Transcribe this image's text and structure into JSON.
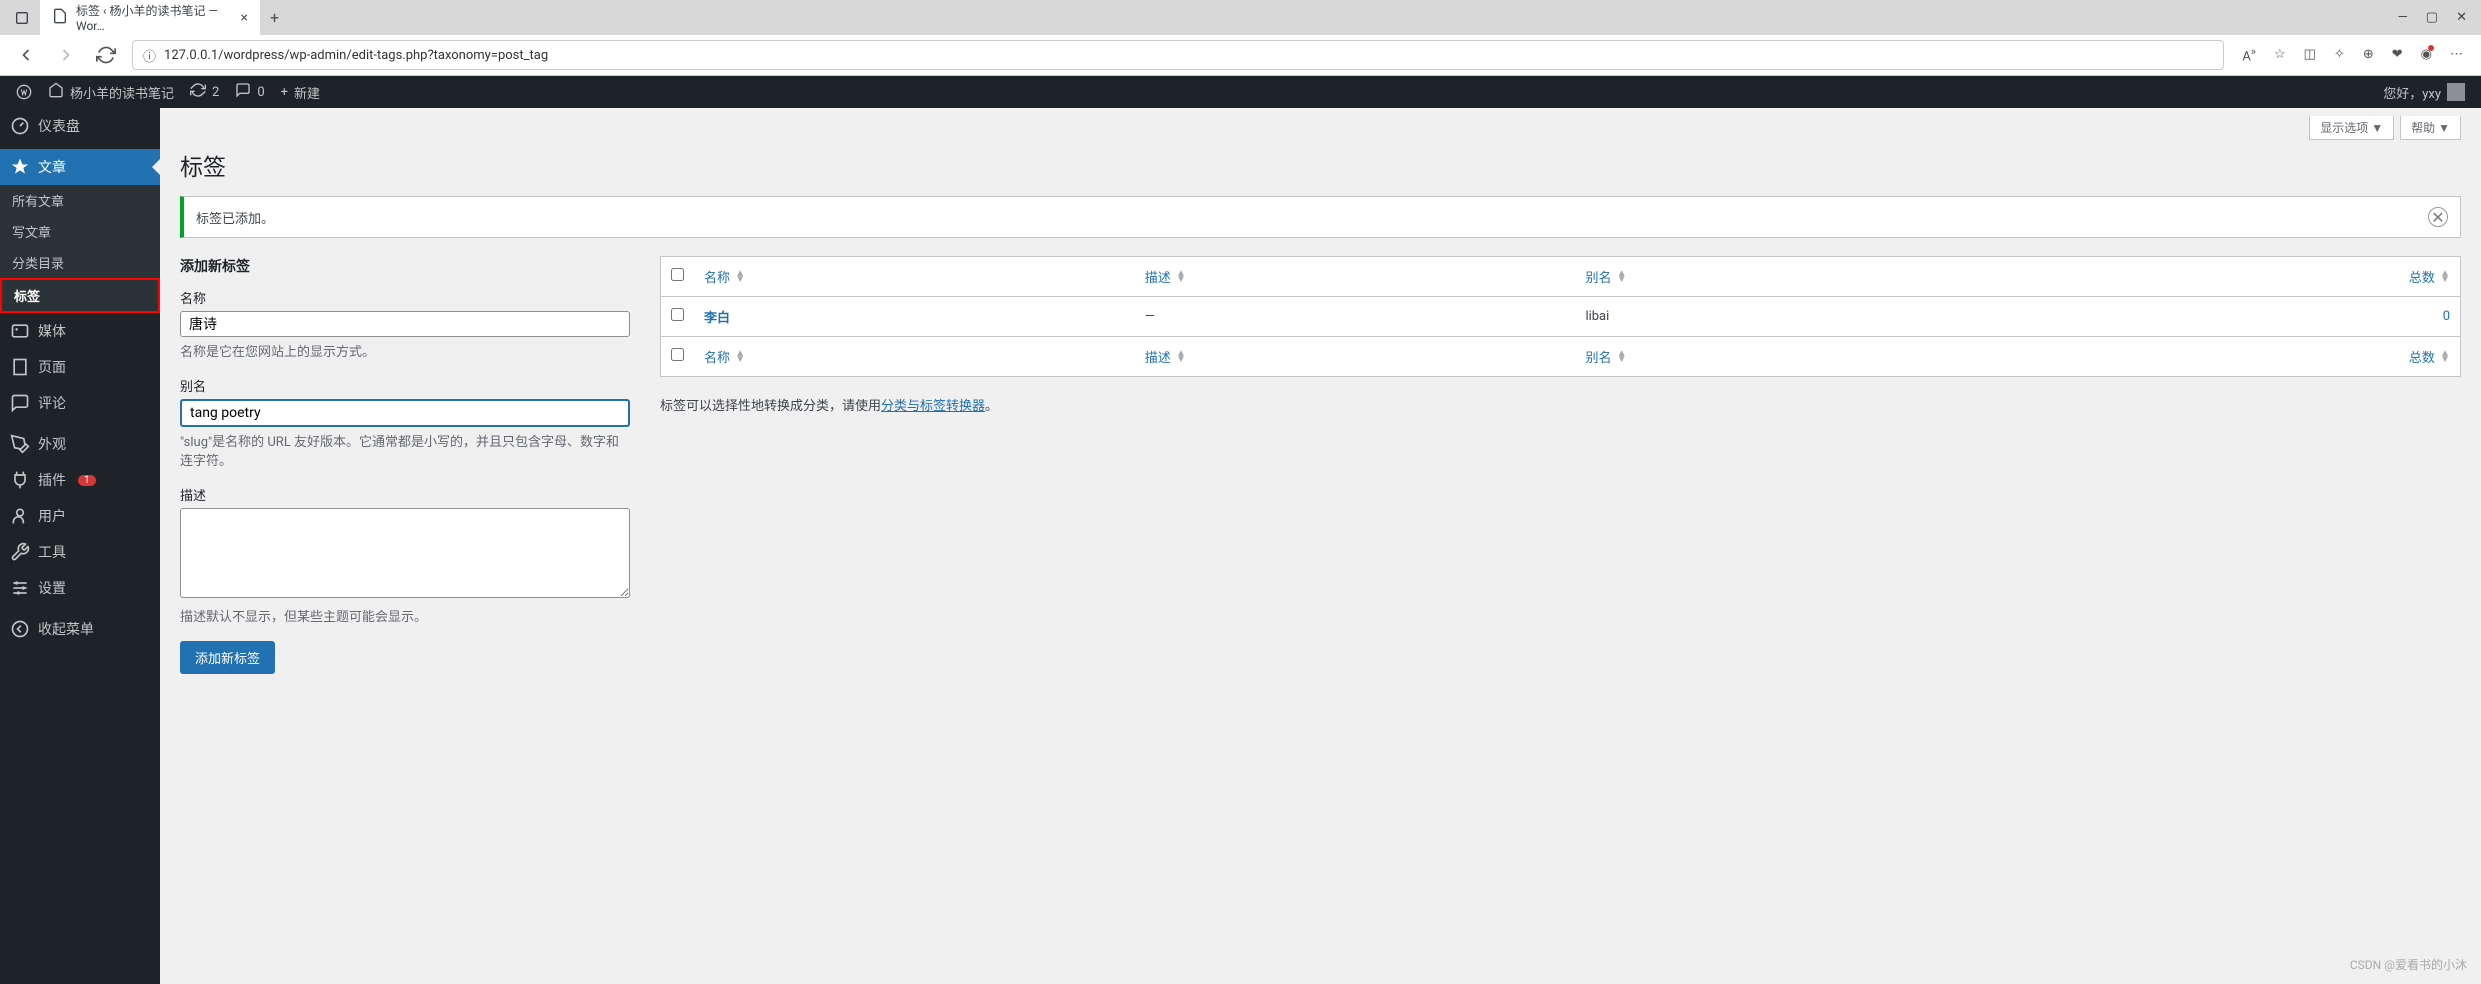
{
  "browser": {
    "tab_title": "标签 ‹ 杨小羊的读书笔记 — Wor…",
    "url": "127.0.0.1/wordpress/wp-admin/edit-tags.php?taxonomy=post_tag"
  },
  "adminbar": {
    "site_name": "杨小羊的读书笔记",
    "updates": "2",
    "comments": "0",
    "new": "新建",
    "greeting": "您好，yxy"
  },
  "sidebar": {
    "dashboard": "仪表盘",
    "posts": "文章",
    "posts_sub": {
      "all": "所有文章",
      "new": "写文章",
      "categories": "分类目录",
      "tags": "标签"
    },
    "media": "媒体",
    "pages": "页面",
    "comments": "评论",
    "appearance": "外观",
    "plugins": "插件",
    "plugins_badge": "1",
    "users": "用户",
    "tools": "工具",
    "settings": "设置",
    "collapse": "收起菜单"
  },
  "screen": {
    "options": "显示选项 ▼",
    "help": "帮助 ▼"
  },
  "page": {
    "title": "标签",
    "notice": "标签已添加。"
  },
  "form": {
    "heading": "添加新标签",
    "name_label": "名称",
    "name_value": "唐诗",
    "name_desc": "名称是它在您网站上的显示方式。",
    "slug_label": "别名",
    "slug_value": "tang poetry",
    "slug_desc": "\"slug\"是名称的 URL 友好版本。它通常都是小写的，并且只包含字母、数字和连字符。",
    "desc_label": "描述",
    "desc_value": "",
    "desc_desc": "描述默认不显示，但某些主题可能会显示。",
    "submit": "添加新标签"
  },
  "table": {
    "col_name": "名称",
    "col_desc": "描述",
    "col_slug": "别名",
    "col_count": "总数",
    "rows": [
      {
        "name": "李白",
        "desc": "—",
        "slug": "libai",
        "count": "0"
      }
    ],
    "convert_text_1": "标签可以选择性地转换成分类，请使用",
    "convert_link": "分类与标签转换器",
    "convert_text_2": "。"
  },
  "watermark": "CSDN @爱看书的小沐"
}
